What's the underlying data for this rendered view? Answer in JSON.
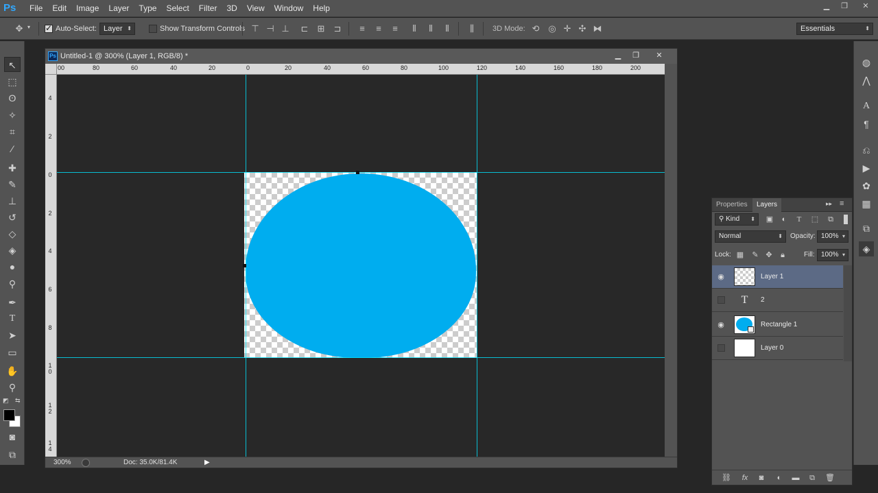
{
  "app": {
    "logo": "Ps",
    "menu": [
      "File",
      "Edit",
      "Image",
      "Layer",
      "Type",
      "Select",
      "Filter",
      "3D",
      "View",
      "Window",
      "Help"
    ],
    "window_controls": [
      "▁",
      "❐",
      "✕"
    ]
  },
  "options_bar": {
    "auto_select_label": "Auto-Select:",
    "auto_select_target": "Layer",
    "show_transform_label": "Show Transform Controls",
    "mode_3d_label": "3D Mode:",
    "workspace": "Essentials"
  },
  "document": {
    "title": "Untitled-1 @ 300% (Layer 1, RGB/8) *",
    "icon_label": "Ps",
    "zoom": "300%",
    "doc_info": "Doc: 35.0K/81.4K",
    "h_ruler_labels": [
      "00",
      "80",
      "60",
      "40",
      "20",
      "0",
      "20",
      "40",
      "60",
      "80",
      "100",
      "120",
      "140",
      "160",
      "180",
      "200"
    ],
    "v_ruler_labels": [
      "4",
      "2",
      "0",
      "2",
      "4",
      "6",
      "8",
      "10",
      "12",
      "14"
    ],
    "shape_color": "#00adef",
    "guide_color": "#00e5ff"
  },
  "layers_panel": {
    "tabs": [
      "Properties",
      "Layers"
    ],
    "active_tab": "Layers",
    "filter_label": "Kind",
    "blend_mode": "Normal",
    "opacity_label": "Opacity:",
    "opacity_value": "100%",
    "lock_label": "Lock:",
    "fill_label": "Fill:",
    "fill_value": "100%",
    "layers": [
      {
        "name": "Layer 1",
        "visible": true,
        "selected": true,
        "thumb": "checker"
      },
      {
        "name": "2",
        "visible": false,
        "selected": false,
        "thumb": "text"
      },
      {
        "name": "Rectangle 1",
        "visible": true,
        "selected": false,
        "thumb": "rect"
      },
      {
        "name": "Layer 0",
        "visible": false,
        "selected": false,
        "thumb": "white"
      }
    ],
    "text_thumb_glyph": "T"
  }
}
